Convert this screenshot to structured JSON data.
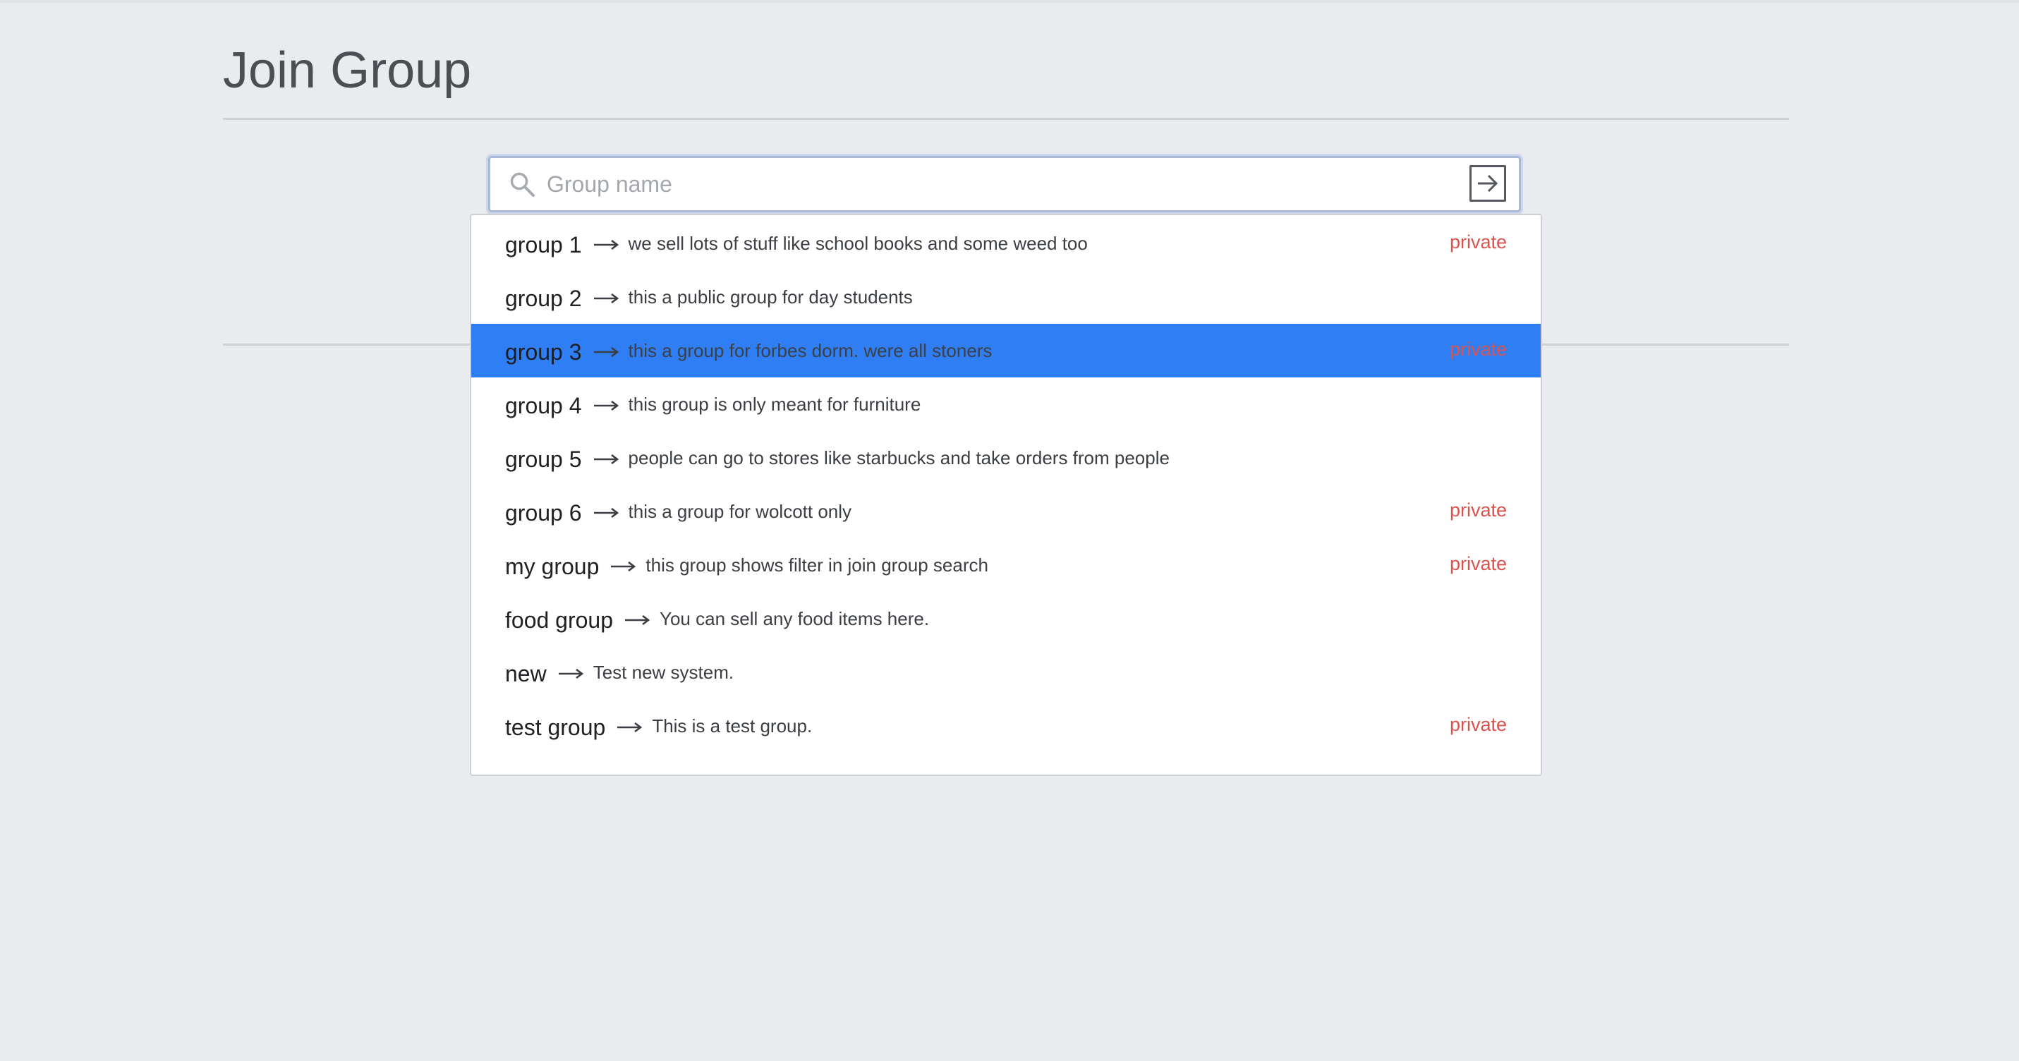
{
  "page": {
    "title": "Join Group"
  },
  "search": {
    "placeholder": "Group name",
    "value": ""
  },
  "icons": {
    "search": "search-icon",
    "submit": "arrow-right-box-icon",
    "separator": "long-arrow-right-icon"
  },
  "colors": {
    "background": "#eaebef",
    "highlight": "#307ef3",
    "private": "#d9534f"
  },
  "results": [
    {
      "name": "group 1",
      "description": "we sell lots of stuff like school books and some weed too",
      "badge": "private",
      "highlighted": false
    },
    {
      "name": "group 2",
      "description": "this a public group for day students",
      "badge": "",
      "highlighted": false
    },
    {
      "name": "group 3",
      "description": "this a group for forbes dorm. were all stoners",
      "badge": "private",
      "highlighted": true
    },
    {
      "name": "group 4",
      "description": "this group is only meant for furniture",
      "badge": "",
      "highlighted": false
    },
    {
      "name": "group 5",
      "description": "people can go to stores like starbucks and take orders from people",
      "badge": "",
      "highlighted": false
    },
    {
      "name": "group 6",
      "description": "this a group for wolcott only",
      "badge": "private",
      "highlighted": false
    },
    {
      "name": "my group",
      "description": "this group shows filter in join group search",
      "badge": "private",
      "highlighted": false
    },
    {
      "name": "food group",
      "description": "You can sell any food items here.",
      "badge": "",
      "highlighted": false
    },
    {
      "name": "new",
      "description": "Test new system.",
      "badge": "",
      "highlighted": false
    },
    {
      "name": "test group",
      "description": "This is a test group.",
      "badge": "private",
      "highlighted": false
    }
  ]
}
